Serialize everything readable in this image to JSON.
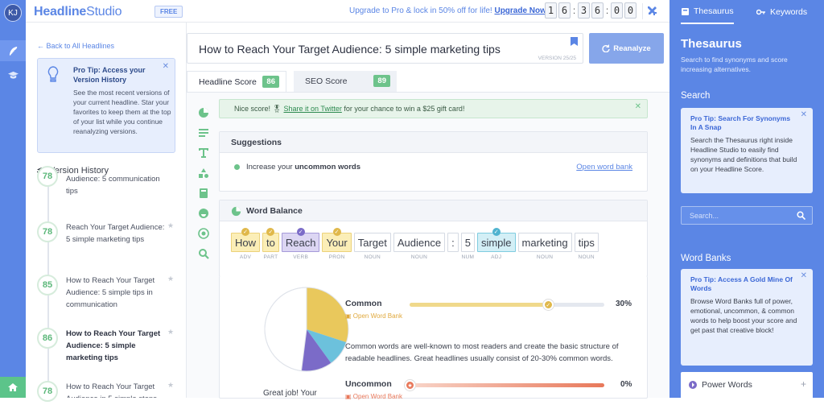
{
  "rail": {
    "avatar_initials": "KJ"
  },
  "topbar": {
    "logo_a": "Headline",
    "logo_b": "Studio",
    "badge": "FREE",
    "upgrade_text": "Upgrade to Pro & lock in 50% off for life!",
    "upgrade_link": "Upgrade Now",
    "timer": [
      "1",
      "6",
      "3",
      "6",
      "0",
      "0"
    ]
  },
  "left": {
    "back": "← Back to All Headlines",
    "tip_title": "Pro Tip: Access your Version History",
    "tip_desc": "See the most recent versions of your current headline. Star your favorites to keep them at the top of your list while you continue reanalyzing versions.",
    "vh_title": "Version History",
    "versions": [
      {
        "score": "78",
        "text": "Audience: 5 communication tips"
      },
      {
        "score": "78",
        "text": "Reach Your Target Audience: 5 simple marketing tips"
      },
      {
        "score": "85",
        "text": "How to Reach Your Target Audience: 5 simple tips in communication"
      },
      {
        "score": "86",
        "text": "How to Reach Your Target Audience: 5 simple marketing tips"
      },
      {
        "score": "78",
        "text": "How to Reach Your Target Audience in 5 simple steps"
      }
    ]
  },
  "main": {
    "headline": "How to Reach Your Target Audience: 5 simple marketing tips",
    "version": "VERSION 25/25",
    "reanalyze": "Reanalyze",
    "tab_hs": "Headline Score",
    "tab_hs_score": "86",
    "tab_seo": "SEO Score",
    "tab_seo_score": "89",
    "notice_a": "Nice score! 🎖",
    "notice_link": "Share it on Twitter",
    "notice_b": "for your chance to win a $25 gift card!",
    "suggestions_title": "Suggestions",
    "suggestion_a": "Increase your",
    "suggestion_b": "uncommon words",
    "open_bank": "Open word bank",
    "wb_title": "Word Balance",
    "words": [
      {
        "w": "How",
        "tag": "ADV",
        "bg": "#fbeeb7",
        "bd": "#ecd27a",
        "mk": "#e0b84a"
      },
      {
        "w": "to",
        "tag": "PART",
        "bg": "#fbeeb7",
        "bd": "#ecd27a",
        "mk": "#e0b84a"
      },
      {
        "w": "Reach",
        "tag": "VERB",
        "bg": "#dcd6f3",
        "bd": "#a69ad9",
        "mk": "#7b6bc8"
      },
      {
        "w": "Your",
        "tag": "PRON",
        "bg": "#fbeeb7",
        "bd": "#ecd27a",
        "mk": "#e0b84a"
      },
      {
        "w": "Target",
        "tag": "NOUN",
        "bg": "#fff",
        "bd": "#d5dae3",
        "mk": ""
      },
      {
        "w": "Audience",
        "tag": "NOUN",
        "bg": "#fff",
        "bd": "#d5dae3",
        "mk": ""
      },
      {
        "w": ":",
        "tag": "",
        "bg": "#fff",
        "bd": "#d5dae3",
        "mk": ""
      },
      {
        "w": "5",
        "tag": "NUM",
        "bg": "#fff",
        "bd": "#d5dae3",
        "mk": ""
      },
      {
        "w": "simple",
        "tag": "ADJ",
        "bg": "#d3eff6",
        "bd": "#7fcce0",
        "mk": "#4fb3cf"
      },
      {
        "w": "marketing",
        "tag": "NOUN",
        "bg": "#fff",
        "bd": "#d5dae3",
        "mk": ""
      },
      {
        "w": "tips",
        "tag": "NOUN",
        "bg": "#fff",
        "bd": "#d5dae3",
        "mk": ""
      }
    ],
    "great_job": "Great job! Your",
    "common_label": "Common",
    "common_pct": "30%",
    "common_value": 0.71,
    "word_bank": "Open Word Bank",
    "common_desc": "Common words are well-known to most readers and create the basic structure of readable headlines. Great headlines usually consist of 20-30% common words.",
    "uncommon_label": "Uncommon",
    "uncommon_pct": "0%",
    "uncommon_value": 0.0
  },
  "right": {
    "tab_thesaurus": "Thesaurus",
    "tab_keywords": "Keywords",
    "title": "Thesaurus",
    "subtitle": "Search to find synonyms and score increasing alternatives.",
    "search_title": "Search",
    "tip1_title": "Pro Tip: Search For Synonyms In A Snap",
    "tip1_desc": "Search the Thesaurus right inside Headline Studio to easily find synonyms and definitions that build on your Headline Score.",
    "search_placeholder": "Search...",
    "banks_title": "Word Banks",
    "tip2_title": "Pro Tip: Access A Gold Mine Of Words",
    "tip2_desc": "Browse Word Banks full of power, emotional, uncommon, & common words to help boost your score and get past that creative block!",
    "power_words": "Power Words"
  },
  "colors": {
    "brand": "#5b86e5",
    "green": "#6dc38b",
    "common": "#e9c85c",
    "uncommon": "#e8785a",
    "purple": "#7b6bc8",
    "cyan": "#6cc1dc"
  }
}
